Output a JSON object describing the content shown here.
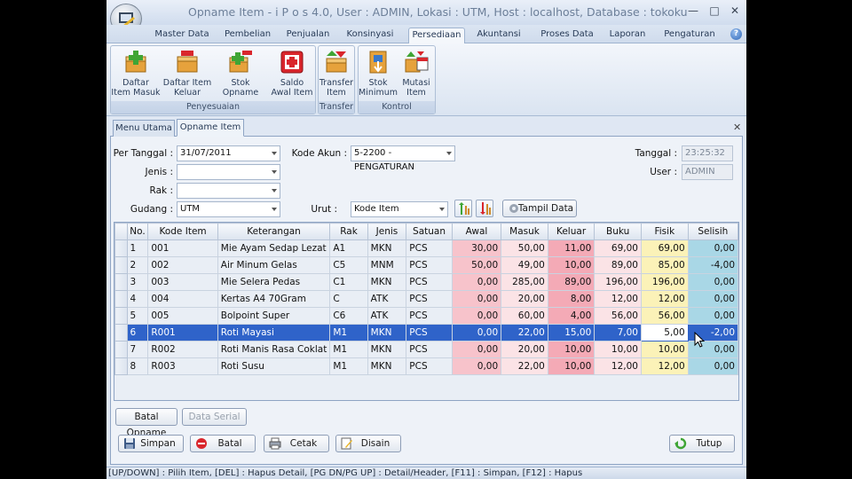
{
  "window": {
    "title": "Opname Item - i P o s 4.0,  User : ADMIN, Lokasi : UTM, Host : localhost, Database : tokoku",
    "min": "—",
    "max": "□",
    "close": "✕"
  },
  "menu_tabs": [
    "Master Data",
    "Pembelian",
    "Penjualan",
    "Konsinyasi",
    "Persediaan",
    "Akuntansi",
    "Proses Data",
    "Laporan",
    "Pengaturan"
  ],
  "active_menu_tab": "Persediaan",
  "help": "?",
  "ribbon": {
    "groups": {
      "penyesuaian": "Penyesuaian",
      "transfer": "Transfer",
      "kontrol": "Kontrol"
    },
    "buttons": {
      "daftar_item_masuk": [
        "Daftar",
        "Item Masuk"
      ],
      "daftar_item_keluar": [
        "Daftar Item",
        "Keluar"
      ],
      "stok_opname": [
        "Stok Opname",
        ""
      ],
      "saldo_awal_item": [
        "Saldo",
        "Awal Item"
      ],
      "transfer_item": [
        "Transfer",
        "Item"
      ],
      "stok_minimum": [
        "Stok",
        "Minimum"
      ],
      "mutasi_item": [
        "Mutasi",
        "Item"
      ]
    }
  },
  "doc_tabs": [
    "Menu Utama",
    "Opname Item"
  ],
  "active_doc_tab": "Opname Item",
  "form": {
    "per_tanggal_label": "Per Tanggal :",
    "per_tanggal": "31/07/2011",
    "jenis_label": "Jenis :",
    "jenis": "",
    "rak_label": "Rak :",
    "rak": "",
    "gudang_label": "Gudang :",
    "gudang": "UTM",
    "kode_akun_label": "Kode Akun :",
    "kode_akun": "5-2200 - PENGATURAN",
    "urut_label": "Urut :",
    "urut": "Kode Item",
    "tanggal_label": "Tanggal :",
    "tanggal": "23:25:32",
    "user_label": "User :",
    "user": "ADMIN",
    "tampil_data": "Tampil Data"
  },
  "table": {
    "columns": [
      "No.",
      "Kode Item",
      "Keterangan",
      "Rak",
      "Jenis",
      "Satuan",
      "Awal",
      "Masuk",
      "Keluar",
      "Buku",
      "Fisik",
      "Selisih"
    ],
    "rows": [
      {
        "no": "1",
        "kode": "001",
        "ket": "Mie Ayam Sedap Lezat",
        "rak": "A1",
        "jenis": "MKN",
        "satuan": "PCS",
        "awal": "30,00",
        "masuk": "50,00",
        "keluar": "11,00",
        "buku": "69,00",
        "fisik": "69,00",
        "selisih": "0,00"
      },
      {
        "no": "2",
        "kode": "002",
        "ket": "Air Minum Gelas",
        "rak": "C5",
        "jenis": "MNM",
        "satuan": "PCS",
        "awal": "50,00",
        "masuk": "49,00",
        "keluar": "10,00",
        "buku": "89,00",
        "fisik": "85,00",
        "selisih": "-4,00"
      },
      {
        "no": "3",
        "kode": "003",
        "ket": "Mie Selera Pedas",
        "rak": "C1",
        "jenis": "MKN",
        "satuan": "PCS",
        "awal": "0,00",
        "masuk": "285,00",
        "keluar": "89,00",
        "buku": "196,00",
        "fisik": "196,00",
        "selisih": "0,00"
      },
      {
        "no": "4",
        "kode": "004",
        "ket": "Kertas A4 70Gram",
        "rak": "C",
        "jenis": "ATK",
        "satuan": "PCS",
        "awal": "0,00",
        "masuk": "20,00",
        "keluar": "8,00",
        "buku": "12,00",
        "fisik": "12,00",
        "selisih": "0,00"
      },
      {
        "no": "5",
        "kode": "005",
        "ket": "Bolpoint Super",
        "rak": "C6",
        "jenis": "ATK",
        "satuan": "PCS",
        "awal": "0,00",
        "masuk": "60,00",
        "keluar": "4,00",
        "buku": "56,00",
        "fisik": "56,00",
        "selisih": "0,00"
      },
      {
        "no": "6",
        "kode": "R001",
        "ket": "Roti Mayasi",
        "rak": "M1",
        "jenis": "MKN",
        "satuan": "PCS",
        "awal": "0,00",
        "masuk": "22,00",
        "keluar": "15,00",
        "buku": "7,00",
        "fisik": "5,00",
        "selisih": "-2,00",
        "selected": true
      },
      {
        "no": "7",
        "kode": "R002",
        "ket": "Roti Manis Rasa Coklat",
        "rak": "M1",
        "jenis": "MKN",
        "satuan": "PCS",
        "awal": "0,00",
        "masuk": "20,00",
        "keluar": "10,00",
        "buku": "10,00",
        "fisik": "10,00",
        "selisih": "0,00"
      },
      {
        "no": "8",
        "kode": "R003",
        "ket": "Roti Susu",
        "rak": "M1",
        "jenis": "MKN",
        "satuan": "PCS",
        "awal": "0,00",
        "masuk": "22,00",
        "keluar": "10,00",
        "buku": "12,00",
        "fisik": "12,00",
        "selisih": "0,00"
      }
    ]
  },
  "buttons": {
    "batal_opname": "Batal Opname",
    "data_serial": "Data Serial",
    "simpan": "Simpan",
    "batal": "Batal",
    "cetak": "Cetak",
    "disain": "Disain",
    "tutup": "Tutup"
  },
  "status_bar": "[UP/DOWN] : Pilih Item, [DEL] : Hapus Detail, [PG DN/PG UP] : Detail/Header, [F11] : Simpan, [F12] : Hapus",
  "colors": {
    "awal": "#f7c3cb",
    "masuk": "#fbe3e6",
    "keluar": "#f4aab6",
    "buku": "#fbe3e6",
    "fisik": "#fbf2b8",
    "selisih": "#a9d7e6",
    "selection": "#2f63c9"
  }
}
